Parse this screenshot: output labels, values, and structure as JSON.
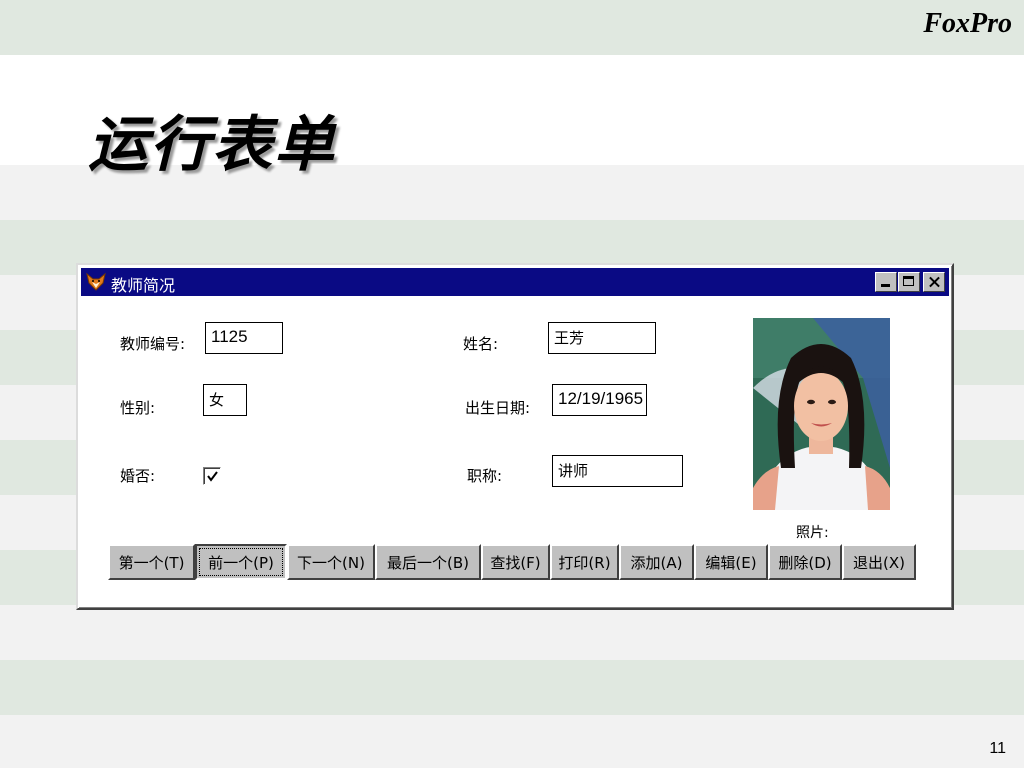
{
  "slide": {
    "brand": "FoxPro",
    "title": "运行表单",
    "page_number": "11"
  },
  "window": {
    "title": "教师简况",
    "icon": "fox-icon"
  },
  "form": {
    "teacher_id_label": "教师编号:",
    "teacher_id_value": "1125",
    "name_label": "姓名:",
    "name_value": "王芳",
    "gender_label": "性别:",
    "gender_value": "女",
    "birthdate_label": "出生日期:",
    "birthdate_value": "12/19/1965",
    "married_label": "婚否:",
    "married_checked": true,
    "title_label": "职称:",
    "title_value": "讲师",
    "photo_label": "照片:"
  },
  "buttons": [
    {
      "label": "第一个(T)"
    },
    {
      "label": "前一个(P)"
    },
    {
      "label": "下一个(N)"
    },
    {
      "label": "最后一个(B)"
    },
    {
      "label": "查找(F)"
    },
    {
      "label": "打印(R)"
    },
    {
      "label": "添加(A)"
    },
    {
      "label": "编辑(E)"
    },
    {
      "label": "删除(D)"
    },
    {
      "label": "退出(X)"
    }
  ]
}
